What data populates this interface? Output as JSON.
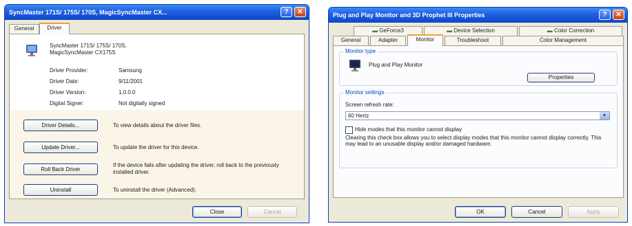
{
  "driver_dialog": {
    "title": "SyncMaster 171S/ 175S/ 170S, MagicSyncMaster CX...",
    "tabs": [
      "General",
      "Driver"
    ],
    "device_name": "SyncMaster 171S/ 175S/ 170S, MagicSyncMaster CX175S",
    "info": [
      {
        "label": "Driver Provider:",
        "value": "Samsung"
      },
      {
        "label": "Driver Date:",
        "value": "9/11/2001"
      },
      {
        "label": "Driver Version:",
        "value": "1.0.0.0"
      },
      {
        "label": "Digital Signer:",
        "value": "Not digitally signed"
      }
    ],
    "actions": [
      {
        "button": "Driver Details...",
        "desc": "To view details about the driver files."
      },
      {
        "button": "Update Driver...",
        "desc": "To update the driver for this device."
      },
      {
        "button": "Roll Back Driver",
        "desc": "If the device fails after updating the driver, roll back to the previously installed driver."
      },
      {
        "button": "Uninstall",
        "desc": "To uninstall the driver (Advanced)."
      }
    ],
    "close_label": "Close",
    "cancel_label": "Cancel"
  },
  "monitor_dialog": {
    "title": "Plug and Play Monitor and 3D Prophet III Properties",
    "tabs_top": [
      "GeForce3",
      "Device Selection",
      "Color Correction"
    ],
    "tabs_bottom": [
      "General",
      "Adapter",
      "Monitor",
      "Troubleshoot",
      "Color Management"
    ],
    "monitor_type_label": "Monitor type",
    "monitor_name": "Plug and Play Monitor",
    "properties_label": "Properties",
    "monitor_settings_label": "Monitor settings",
    "refresh_label": "Screen refresh rate:",
    "refresh_value": "60 Hertz",
    "hide_modes_label": "Hide modes that this monitor cannot display",
    "hide_modes_desc": "Clearing this check box allows you to select display modes that this monitor cannot display correctly. This may lead to an unusable display and/or damaged hardware.",
    "ok_label": "OK",
    "cancel_label": "Cancel",
    "apply_label": "Apply"
  }
}
